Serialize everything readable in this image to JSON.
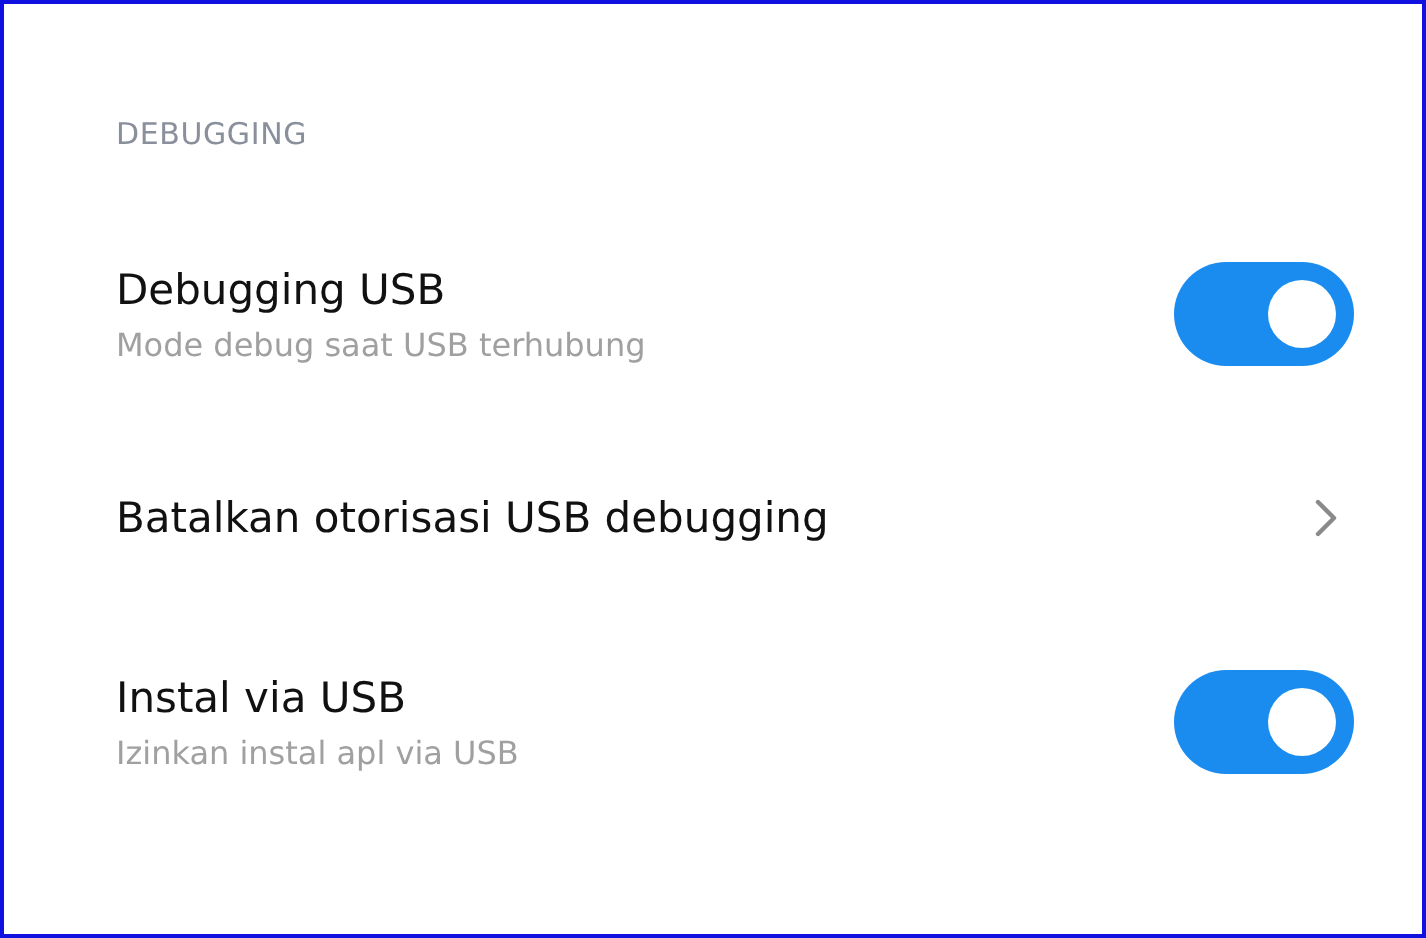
{
  "section": {
    "header": "DEBUGGING"
  },
  "rows": [
    {
      "kind": "toggle",
      "title": "Debugging USB",
      "subtitle": "Mode debug saat USB terhubung",
      "on": true
    },
    {
      "kind": "link",
      "title": "Batalkan otorisasi USB debugging"
    },
    {
      "kind": "toggle",
      "title": "Instal via USB",
      "subtitle": "Izinkan instal apl via USB",
      "on": true
    }
  ]
}
